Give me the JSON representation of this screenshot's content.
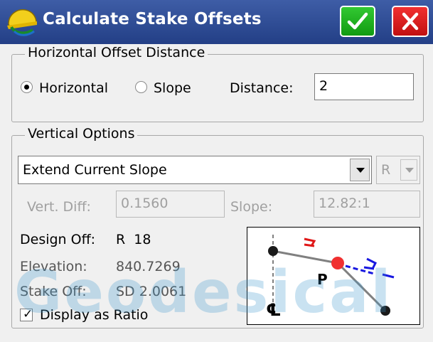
{
  "window": {
    "title": "Calculate Stake Offsets",
    "ok_icon": "checkmark-icon",
    "close_icon": "close-icon",
    "app_icon": "carlson-helmet-icon",
    "colors": {
      "title_bar": "#2d4b94",
      "ok": "#1fb41f",
      "close": "#dd1c1c"
    }
  },
  "horizontal_group": {
    "legend": "Horizontal Offset Distance",
    "radio_horizontal": "Horizontal",
    "radio_slope": "Slope",
    "selected": "Horizontal",
    "distance_label": "Distance:",
    "distance_value": "2"
  },
  "vertical_group": {
    "legend": "Vertical Options",
    "option_selected": "Extend Current Slope",
    "side_selected": "R",
    "vert_diff_label": "Vert. Diff:",
    "vert_diff_value": "0.1560",
    "slope_label": "Slope:",
    "slope_value": "12.82:1"
  },
  "results": {
    "design_off_label": "Design Off:",
    "design_off_value": "R  18",
    "elevation_label": "Elevation:",
    "elevation_value": "840.7269",
    "stake_off_label": "Stake Off:",
    "stake_off_value": "SD 2.0061"
  },
  "display_as_ratio": {
    "label": "Display as Ratio",
    "checked": true
  },
  "diagram": {
    "point_label": "P",
    "centerline_symbol": "℄"
  },
  "watermark": "Geodesical"
}
